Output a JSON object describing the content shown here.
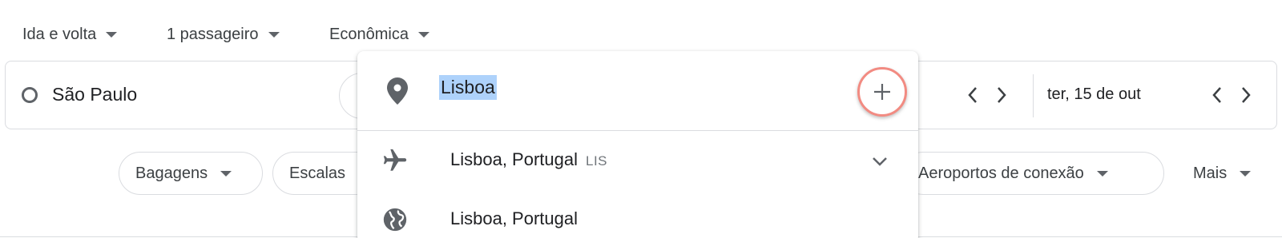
{
  "options": {
    "trip_type": "Ida e volta",
    "passengers": "1 passageiro",
    "cabin_class": "Econômica"
  },
  "search": {
    "origin": "São Paulo",
    "destination_input": "Lisboa",
    "return_date": "ter, 15 de out"
  },
  "filters": {
    "bags": "Bagagens",
    "stops": "Escalas",
    "connecting_airports": "Aeroportos de conexão",
    "more": "Mais"
  },
  "suggestions": [
    {
      "label": "Lisboa, Portugal",
      "code": "LIS",
      "icon": "airplane-icon"
    },
    {
      "label": "Lisboa, Portugal",
      "icon": "globe-icon"
    }
  ],
  "colors": {
    "selection_highlight": "#aed2fb",
    "add_button_ring": "#f28b82"
  }
}
